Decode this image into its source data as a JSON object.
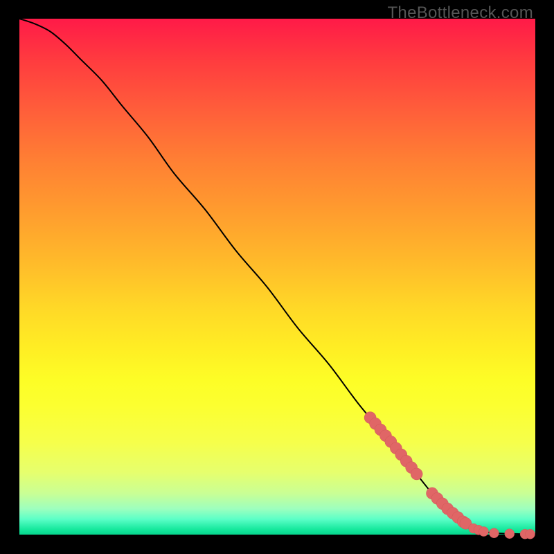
{
  "watermark": "TheBottleneck.com",
  "chart_data": {
    "type": "line",
    "title": "",
    "xlabel": "",
    "ylabel": "",
    "xlim": [
      0,
      100
    ],
    "ylim": [
      0,
      100
    ],
    "grid": false,
    "series": [
      {
        "name": "curve",
        "x": [
          0,
          3,
          6,
          9,
          12,
          16,
          20,
          25,
          30,
          36,
          42,
          48,
          54,
          60,
          66,
          72,
          76,
          80,
          83,
          86,
          88,
          90,
          92,
          94,
          96,
          98,
          100
        ],
        "y": [
          100,
          99,
          97.5,
          95,
          92,
          88,
          83,
          77,
          70,
          63,
          55,
          48,
          40,
          33,
          25,
          18,
          13,
          8,
          5,
          2.5,
          1.2,
          0.6,
          0.3,
          0.2,
          0.15,
          0.1,
          0.1
        ]
      }
    ],
    "markers": [
      {
        "name": "highlight-cluster-upper",
        "points_x": [
          68,
          69,
          70,
          71,
          72,
          73,
          74,
          75,
          76,
          77
        ],
        "radius": 8.5
      },
      {
        "name": "highlight-cluster-lower",
        "points_x": [
          80,
          81,
          82,
          83,
          84,
          85,
          86,
          86.5
        ],
        "radius": 8.5
      },
      {
        "name": "highlight-tail",
        "points_x": [
          88,
          89,
          90,
          92,
          95,
          98,
          99
        ],
        "radius": 7
      }
    ]
  }
}
